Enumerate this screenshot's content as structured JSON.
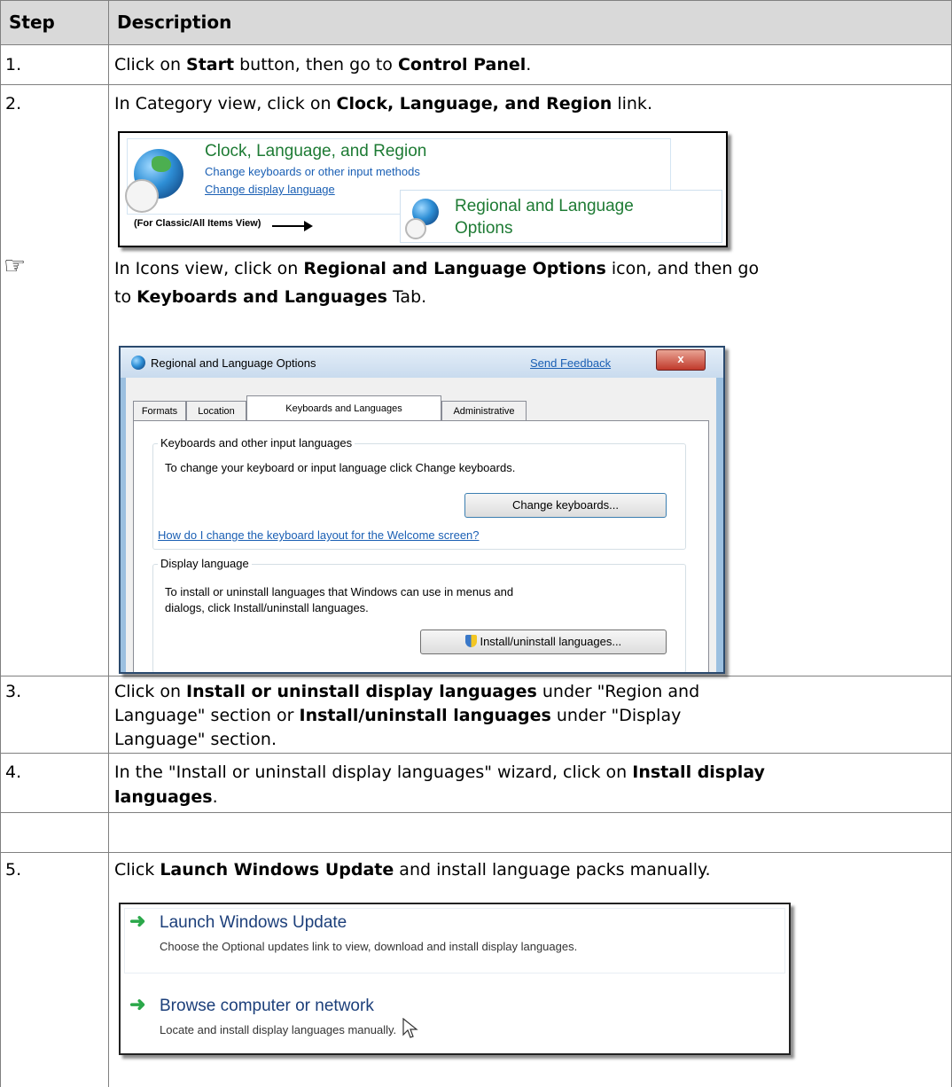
{
  "table": {
    "header": {
      "step": "Step",
      "description": "Description"
    },
    "rows": [
      {
        "step": "1.",
        "parts": [
          "Click on ",
          "Start",
          " button, then go to ",
          "Control Panel",
          "."
        ]
      },
      {
        "step": "2.",
        "parts": [
          "In Category view, click on ",
          "Clock, Language, and Region",
          " link."
        ]
      },
      {
        "note_line1": [
          "In Icons view, click on ",
          "Regional and Language Options",
          " icon, and then go"
        ],
        "note_line2": [
          "to ",
          "Keyboards and Languages",
          " Tab."
        ]
      },
      {
        "step": "3.",
        "line1": [
          "Click on ",
          "Install or uninstall display languages",
          " under \"Region and"
        ],
        "line2": [
          "Language\" section or ",
          "Install/uninstall languages",
          " under \"Display"
        ],
        "line3": "Language\" section."
      },
      {
        "step": "4.",
        "line1": [
          "In the \"Install or uninstall display languages\" wizard, click on ",
          "Install display"
        ],
        "line2": [
          "languages",
          "."
        ]
      },
      {
        "step": "5.",
        "parts": [
          "Click ",
          "Launch Windows Update",
          " and install language packs manually."
        ]
      }
    ],
    "note_icon": "pointing-hand-icon"
  },
  "shot1": {
    "title": "Clock, Language, and Region",
    "link1": "Change keyboards or other input methods",
    "link2": "Change display language",
    "classic": "(For Classic/All Items View)",
    "regional_line1": "Regional and Language",
    "regional_line2": "Options"
  },
  "shot2": {
    "title": "Regional and Language Options",
    "send_feedback": "Send Feedback",
    "close": "x",
    "tabs": [
      "Formats",
      "Location",
      "Keyboards and Languages",
      "Administrative"
    ],
    "group1_legend": "Keyboards and other input languages",
    "group1_text": "To change your keyboard or input language click Change keyboards.",
    "change_keyboards": "Change keyboards...",
    "welcome_link": "How do I change the keyboard layout for the Welcome screen?",
    "group2_legend": "Display language",
    "group2_text1": "To install or uninstall languages that Windows can use in menus and",
    "group2_text2": "dialogs, click Install/uninstall languages.",
    "install_button": "Install/uninstall languages..."
  },
  "shot3": {
    "opt1_title": "Launch Windows Update",
    "opt1_desc": "Choose the Optional updates link to view, download and install display languages.",
    "opt2_title": "Browse computer or network",
    "opt2_desc": "Locate and install display languages manually."
  },
  "colors": {
    "header_bg": "#d9d9d9",
    "link": "#1a5fb4",
    "green_title": "#1e7b34",
    "arrow_green": "#2ba84a"
  }
}
